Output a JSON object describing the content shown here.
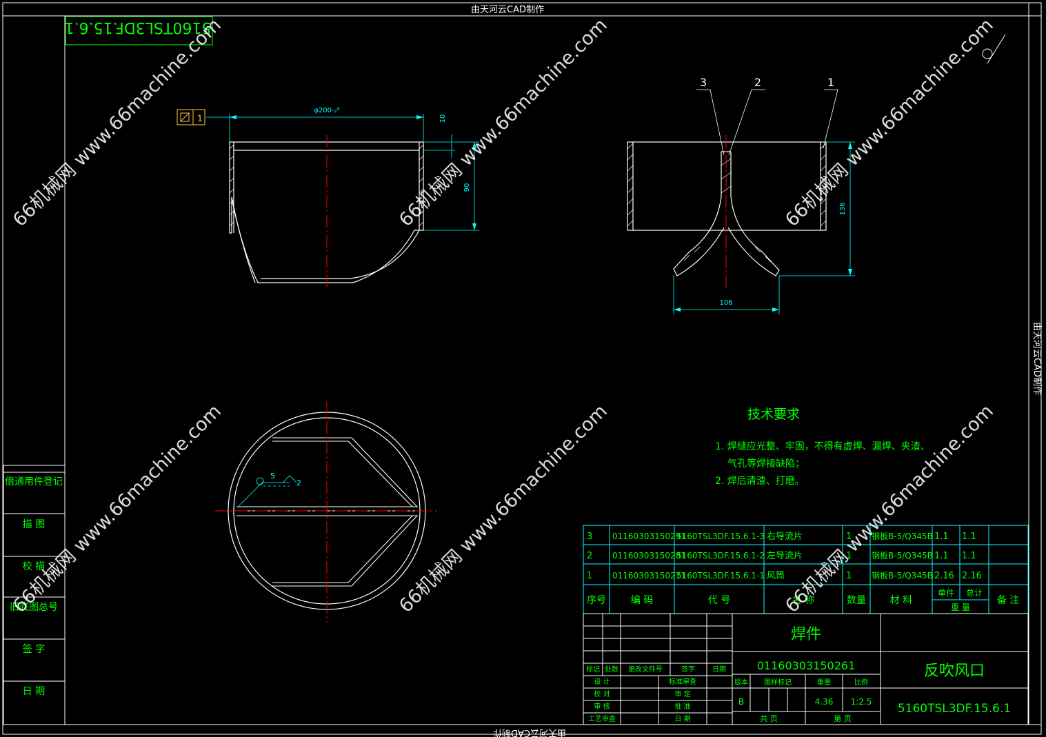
{
  "header_text": "由天河云CAD制作",
  "footer_text": "由天河云CAD制作",
  "side_text": "由天河云CAD制作",
  "drawing_code_mirrored": "5160TSL3DF.15.6.1",
  "watermark_text": "66机械网 www.66machine.com",
  "colors": {
    "bg": "#000000",
    "frame": "#ffffff",
    "dim": "#00ffff",
    "text_green": "#00ff00",
    "center_red": "#ff0000",
    "table": "#00ffff",
    "gold": "#ffcc33"
  },
  "front_view": {
    "datum_label": "1",
    "dim_diameter": "φ200-₂⁰",
    "dim_top": "10",
    "dim_height": "90"
  },
  "side_view": {
    "balloons": [
      "3",
      "2",
      "1"
    ],
    "dim_height": "136",
    "dim_width": "106"
  },
  "plan_view": {
    "weld_size": "5",
    "weld_count": "2"
  },
  "left_column": [
    "借通用件登记",
    "描  图",
    "校  描",
    "旧底图总号",
    "签  字",
    "日  期"
  ],
  "tech_requirements": {
    "title": "技术要求",
    "lines": [
      "1. 焊缝应光整、牢固，不得有虚焊、漏焊、夹渣、",
      "气孔等焊接缺陷；",
      "2. 焊后清渣、打磨。"
    ]
  },
  "bom": {
    "rows": [
      [
        "3",
        "01160303150291",
        "5160TSL3DF.15.6.1-3",
        "右导流片",
        "1",
        "钢板B-5/Q345B",
        "1.1",
        "1.1",
        ""
      ],
      [
        "2",
        "01160303150281",
        "5160TSL3DF.15.6.1-2",
        "左导流片",
        "1",
        "钢板B-5/Q345B",
        "1.1",
        "1.1",
        ""
      ],
      [
        "1",
        "01160303150271",
        "5160TSL3DF.15.6.1-1",
        "风筒",
        "1",
        "钢板B-5/Q345B",
        "2.16",
        "2.16",
        ""
      ]
    ],
    "headers": [
      "序号",
      "编    码",
      "代    号",
      "名    称",
      "数量",
      "材    料",
      "单件",
      "总计",
      "备  注"
    ],
    "weight_header": "重    量"
  },
  "title_block": {
    "type": "焊件",
    "code": "01160303150261",
    "part_name": "反吹风口",
    "drawing_no": "5160TSL3DF.15.6.1",
    "rev_header": [
      "标记",
      "处数",
      "更改文件号",
      "签字",
      "日期"
    ],
    "sign_rows": [
      [
        "设 计",
        "标准审查"
      ],
      [
        "校 对",
        "审 定"
      ],
      [
        "审 核",
        "批 准"
      ],
      [
        "工艺审查",
        "日 期"
      ]
    ],
    "mid_headers": [
      "版本",
      "图样标记",
      "重量",
      "比例"
    ],
    "version": "B",
    "weight": "4.36",
    "scale": "1:2.5",
    "sheet_total": "共    页",
    "sheet_no": "第    页"
  }
}
